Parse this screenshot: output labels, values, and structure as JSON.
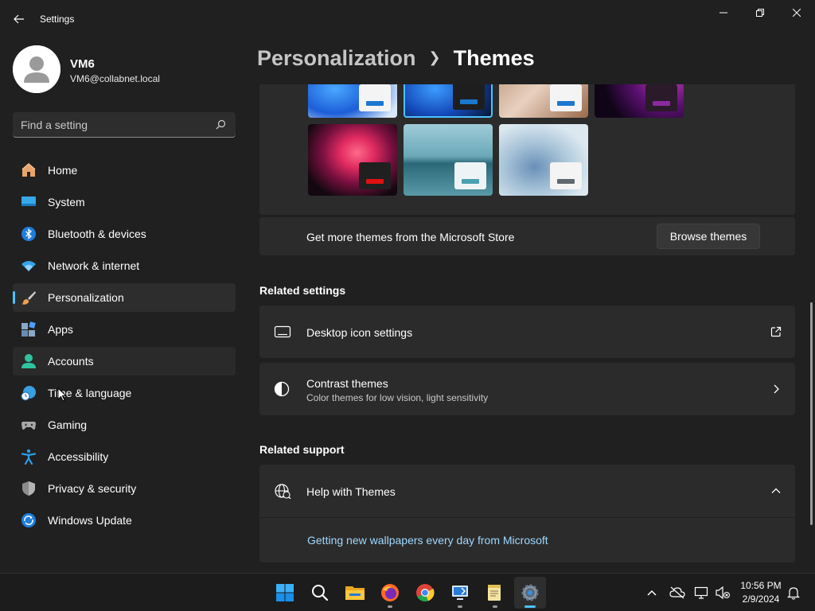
{
  "window": {
    "title": "Settings"
  },
  "user": {
    "name": "VM6",
    "email": "VM6@collabnet.local"
  },
  "search": {
    "placeholder": "Find a setting"
  },
  "nav": [
    {
      "label": "Home",
      "icon": "home-icon"
    },
    {
      "label": "System",
      "icon": "monitor-icon"
    },
    {
      "label": "Bluetooth & devices",
      "icon": "bluetooth-icon"
    },
    {
      "label": "Network & internet",
      "icon": "wifi-icon"
    },
    {
      "label": "Personalization",
      "icon": "paintbrush-icon",
      "selected": true
    },
    {
      "label": "Apps",
      "icon": "apps-icon"
    },
    {
      "label": "Accounts",
      "icon": "person-icon"
    },
    {
      "label": "Time & language",
      "icon": "clock-globe-icon"
    },
    {
      "label": "Gaming",
      "icon": "gamepad-icon"
    },
    {
      "label": "Accessibility",
      "icon": "accessibility-icon"
    },
    {
      "label": "Privacy & security",
      "icon": "shield-icon"
    },
    {
      "label": "Windows Update",
      "icon": "update-icon"
    }
  ],
  "breadcrumb": {
    "parent": "Personalization",
    "current": "Themes"
  },
  "themes": {
    "store_text": "Get more themes from the Microsoft Store",
    "browse_button": "Browse themes"
  },
  "related_settings": {
    "title": "Related settings",
    "desktop_icons": {
      "label": "Desktop icon settings"
    },
    "contrast": {
      "label": "Contrast themes",
      "description": "Color themes for low vision, light sensitivity"
    }
  },
  "related_support": {
    "title": "Related support",
    "help": {
      "label": "Help with Themes",
      "link": "Getting new wallpapers every day from Microsoft"
    }
  },
  "clock": {
    "time": "10:56 PM",
    "date": "2/9/2024"
  },
  "colors": {
    "accent": "#4cc2ff",
    "background": "#202020",
    "card": "#2b2b2b",
    "link": "#9fd8ff"
  }
}
